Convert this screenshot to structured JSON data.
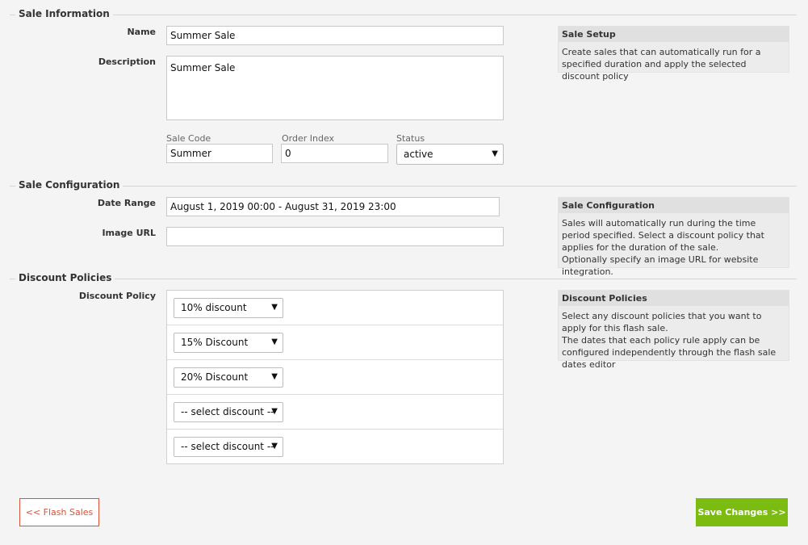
{
  "sections": {
    "sale_information": "Sale Information",
    "sale_configuration": "Sale Configuration",
    "discount_policies": "Discount Policies"
  },
  "sale_info": {
    "name_label": "Name",
    "name_value": "Summer Sale",
    "description_label": "Description",
    "description_value": "Summer Sale",
    "sale_code_label": "Sale Code",
    "sale_code_value": "Summer",
    "order_index_label": "Order Index",
    "order_index_value": "0",
    "status_label": "Status",
    "status_value": "active"
  },
  "sale_config": {
    "date_range_label": "Date Range",
    "date_range_value": "August 1, 2019 00:00 - August 31, 2019 23:00",
    "image_url_label": "Image URL",
    "image_url_value": ""
  },
  "discount": {
    "label": "Discount Policy",
    "policies": [
      "10% discount",
      "15% Discount",
      "20% Discount",
      "-- select discount --",
      "-- select discount --"
    ]
  },
  "info_boxes": {
    "setup": {
      "title": "Sale Setup",
      "lines": [
        "Create sales that can automatically run for a specified duration and apply the selected discount policy"
      ]
    },
    "configuration": {
      "title": "Sale Configuration",
      "lines": [
        "Sales will automatically run during the time period specified. Select a discount policy that applies for the duration of the sale.",
        "Optionally specify an image URL for website integration."
      ]
    },
    "policies": {
      "title": "Discount Policies",
      "lines": [
        "Select any discount policies that you want to apply for this flash sale.",
        "The dates that each policy rule apply can be configured independently through the flash sale dates editor"
      ]
    }
  },
  "buttons": {
    "back": "<< Flash Sales",
    "save": "Save Changes >>"
  },
  "icons": {
    "caret": "caret-down-icon"
  }
}
